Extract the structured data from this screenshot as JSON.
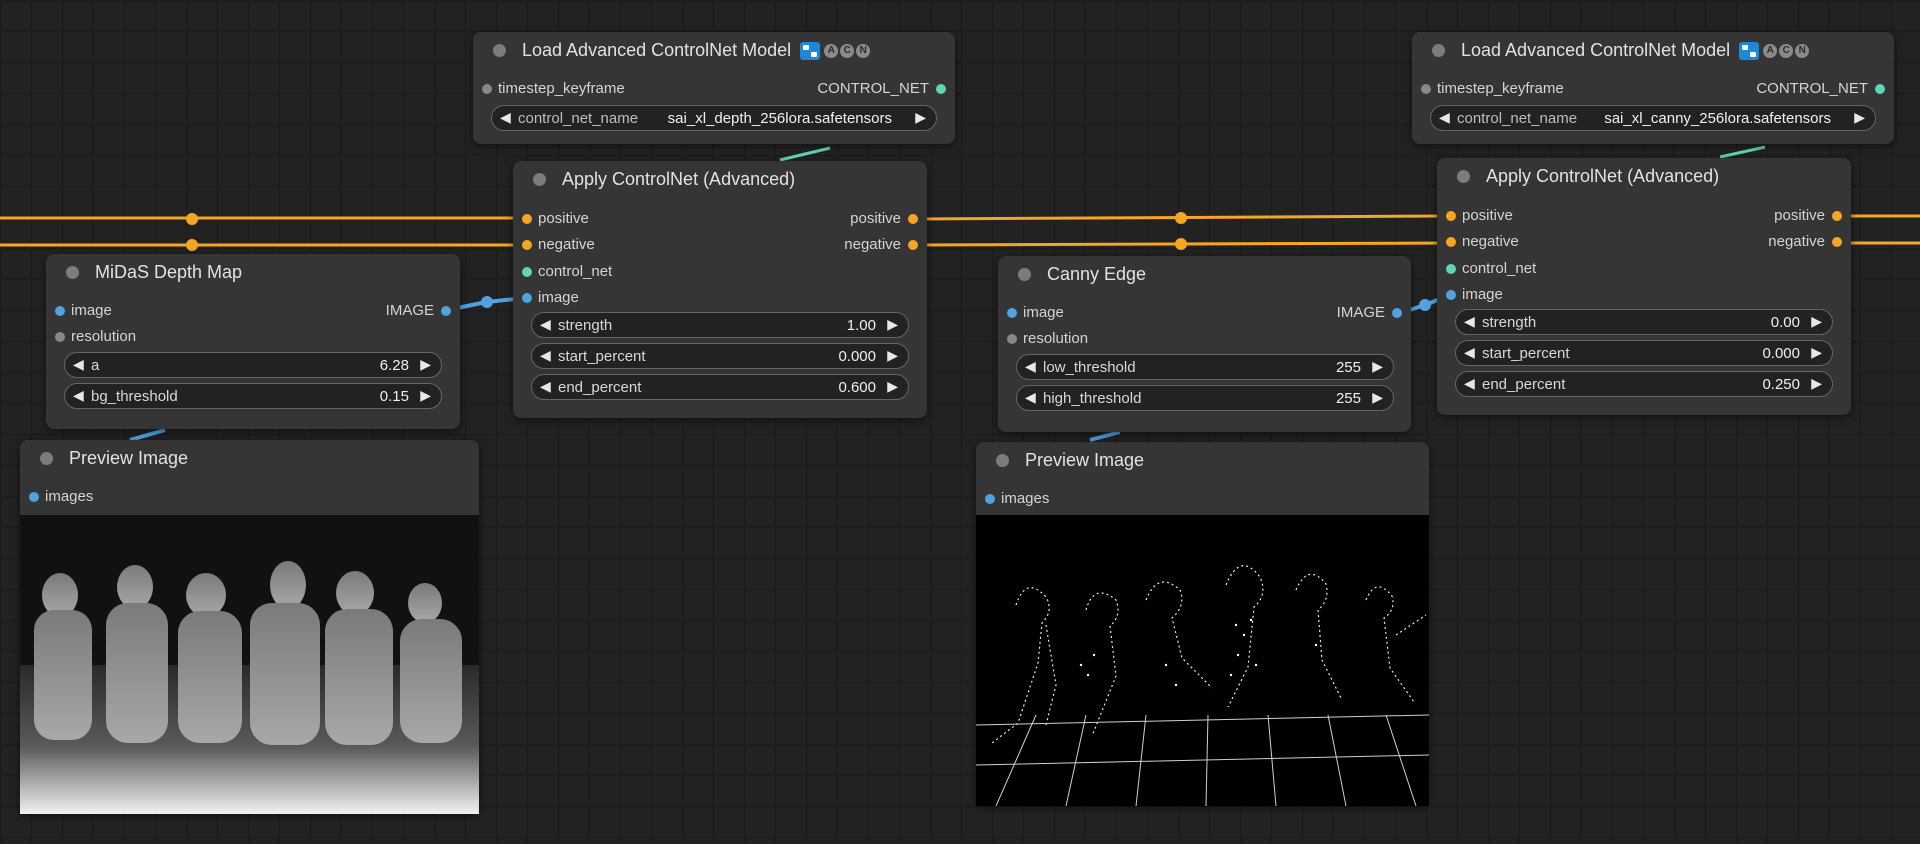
{
  "colors": {
    "canvas_bg": "#222222",
    "node_bg": "#353535",
    "conditioning_wire": "#f5a623",
    "image_wire": "#4fa3e0",
    "control_net_wire": "#5fd6b4",
    "slot_gray": "#888888"
  },
  "load_cn_1": {
    "title": "Load Advanced ControlNet Model",
    "input_timestep": "timestep_keyframe",
    "output_control_net": "CONTROL_NET",
    "widget_label": "control_net_name",
    "widget_value": "sai_xl_depth_256lora.safetensors",
    "badge_letters": [
      "A",
      "C",
      "N"
    ]
  },
  "load_cn_2": {
    "title": "Load Advanced ControlNet Model",
    "input_timestep": "timestep_keyframe",
    "output_control_net": "CONTROL_NET",
    "widget_label": "control_net_name",
    "widget_value": "sai_xl_canny_256lora.safetensors",
    "badge_letters": [
      "A",
      "C",
      "N"
    ]
  },
  "apply_cn_1": {
    "title": "Apply ControlNet (Advanced)",
    "inputs": [
      "positive",
      "negative",
      "control_net",
      "image"
    ],
    "outputs": [
      "positive",
      "negative"
    ],
    "widgets": [
      {
        "label": "strength",
        "value": "1.00"
      },
      {
        "label": "start_percent",
        "value": "0.000"
      },
      {
        "label": "end_percent",
        "value": "0.600"
      }
    ]
  },
  "apply_cn_2": {
    "title": "Apply ControlNet (Advanced)",
    "inputs": [
      "positive",
      "negative",
      "control_net",
      "image"
    ],
    "outputs": [
      "positive",
      "negative"
    ],
    "widgets": [
      {
        "label": "strength",
        "value": "0.00"
      },
      {
        "label": "start_percent",
        "value": "0.000"
      },
      {
        "label": "end_percent",
        "value": "0.250"
      }
    ]
  },
  "midas": {
    "title": "MiDaS Depth Map",
    "inputs": [
      "image",
      "resolution"
    ],
    "output": "IMAGE",
    "widgets": [
      {
        "label": "a",
        "value": "6.28"
      },
      {
        "label": "bg_threshold",
        "value": "0.15"
      }
    ]
  },
  "canny": {
    "title": "Canny Edge",
    "inputs": [
      "image",
      "resolution"
    ],
    "output": "IMAGE",
    "widgets": [
      {
        "label": "low_threshold",
        "value": "255"
      },
      {
        "label": "high_threshold",
        "value": "255"
      }
    ]
  },
  "preview_1": {
    "title": "Preview Image",
    "input": "images"
  },
  "preview_2": {
    "title": "Preview Image",
    "input": "images"
  }
}
